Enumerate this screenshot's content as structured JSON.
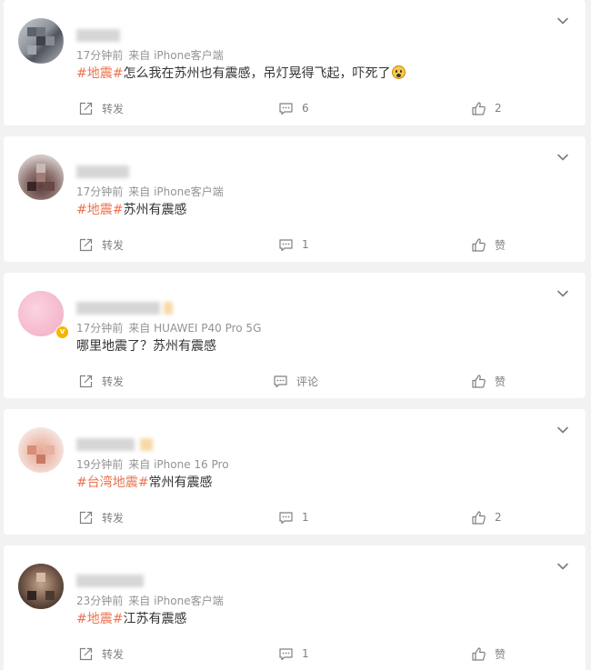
{
  "posts": [
    {
      "time": "17分钟前",
      "source": "来自 iPhone客户端",
      "tags": [
        "#地震#"
      ],
      "text": "怎么我在苏州也有震感，吊灯晃得飞起，吓死了",
      "emoji": "scared-face-emoji",
      "repost_label": "转发",
      "comment_label": "6",
      "like_label": "2",
      "verified": false
    },
    {
      "time": "17分钟前",
      "source": "来自 iPhone客户端",
      "tags": [
        "#地震#"
      ],
      "text": "苏州有震感",
      "repost_label": "转发",
      "comment_label": "1",
      "like_label": "赞",
      "verified": false
    },
    {
      "time": "17分钟前",
      "source": "来自 HUAWEI P40 Pro 5G",
      "tags": [],
      "text": "哪里地震了？苏州有震感",
      "repost_label": "转发",
      "comment_label": "评论",
      "like_label": "赞",
      "verified": true
    },
    {
      "time": "19分钟前",
      "source": "来自 iPhone 16 Pro",
      "tags": [
        "#台湾地震#"
      ],
      "text": "常州有震感",
      "repost_label": "转发",
      "comment_label": "1",
      "like_label": "2",
      "verified": false
    },
    {
      "time": "23分钟前",
      "source": "来自 iPhone客户端",
      "tags": [
        "#地震#"
      ],
      "text": "江苏有震感",
      "repost_label": "转发",
      "comment_label": "1",
      "like_label": "赞",
      "verified": false
    }
  ],
  "colors": {
    "background": "#f2f2f2",
    "card": "#ffffff",
    "hashtag": "#eb7350",
    "meta_text": "#939393",
    "action_text": "#808080",
    "verified_badge": "#f7b500"
  },
  "icons": {
    "repost": "repost-icon",
    "comment": "comment-icon",
    "like": "thumbs-up-icon",
    "menu": "chevron-down-icon"
  }
}
